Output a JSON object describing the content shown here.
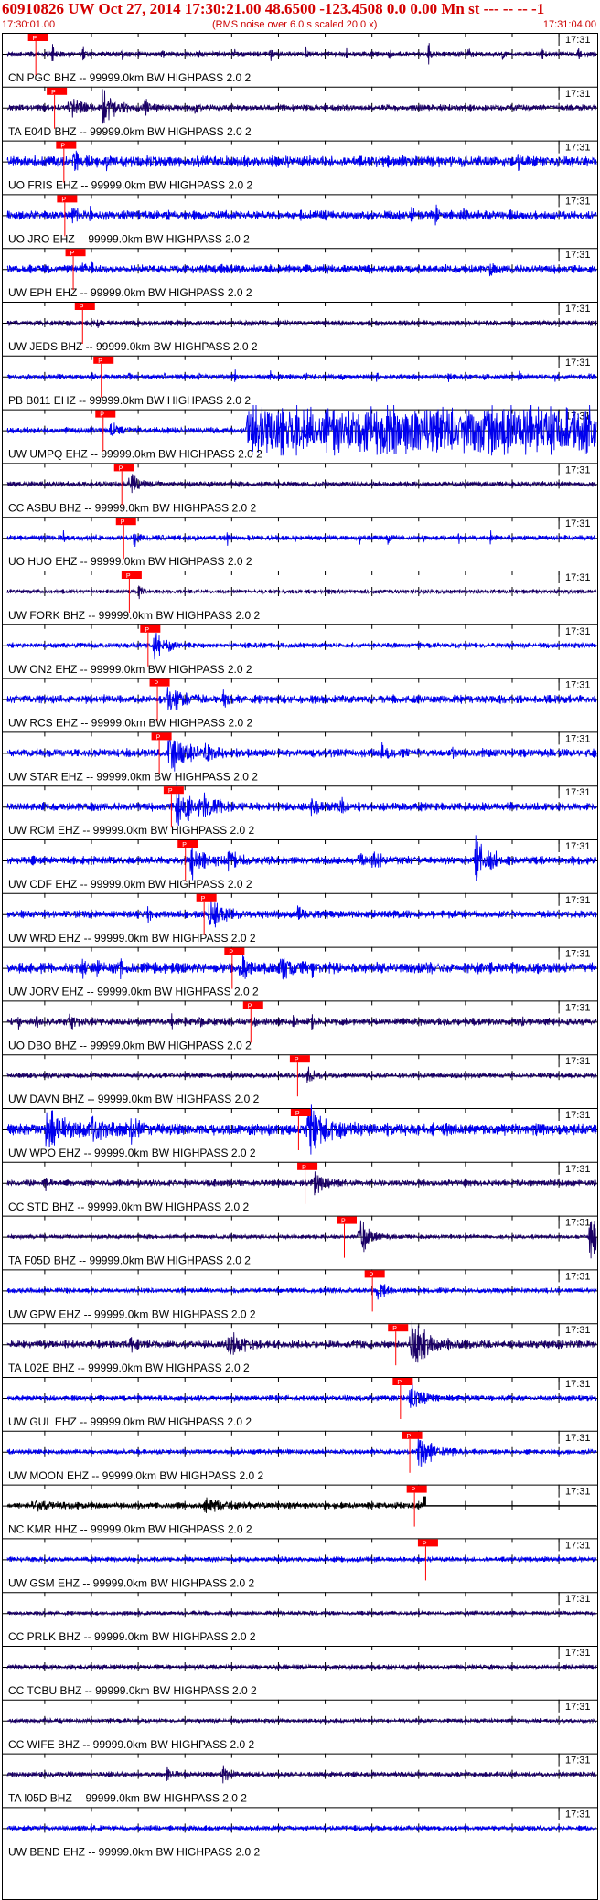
{
  "header": {
    "title": "60910826 UW Oct 27, 2014 17:30:21.00   48.6500  -123.4508   0.0  0.00 Mn st --- -- --  -1",
    "start_time": "17:30:01.00",
    "rms_note": "(RMS noise over 6.0 s scaled 20.0 x)",
    "end_time": "17:31:04.00"
  },
  "chart_data": {
    "type": "line",
    "title": "60910826 UW Oct 27, 2014 17:30:21.00   48.6500  -123.4508   0.0  0.00 Mn st --- -- --  -1",
    "time_axis": {
      "start": "17:30:01.00",
      "end": "17:31:04.00",
      "minute_tick_label": "17:31",
      "start_seconds": 1.0,
      "end_seconds": 64.0,
      "minute_mark_seconds": 60.0
    },
    "pick_label": "P",
    "colors": {
      "trace_blue": "#0000ee",
      "trace_dark": "#1a0066",
      "pick": "#ff0000",
      "header_text": "#cc0000",
      "axis": "#000000"
    },
    "series": [
      {
        "name": "CN PGC BHZ -- 99999.0km BW  HIGHPASS  2.0  2",
        "color": "#1a0066",
        "pick_seconds": 4.0,
        "amp": 0.35,
        "noise": 0.08,
        "seed": 1,
        "events": [
          [
            5.8,
            0.25,
            0.5
          ],
          [
            9.0,
            0.25,
            0.5
          ],
          [
            13.2,
            0.2,
            0.5
          ],
          [
            17.5,
            0.2,
            0.5
          ],
          [
            21.5,
            0.2,
            0.5
          ],
          [
            25.3,
            0.2,
            0.5
          ],
          [
            29.1,
            0.25,
            0.5
          ],
          [
            32.9,
            0.2,
            0.5
          ],
          [
            37.2,
            0.2,
            0.5
          ],
          [
            41.8,
            0.2,
            0.5
          ],
          [
            46.0,
            0.3,
            0.6
          ],
          [
            50.3,
            0.3,
            0.5
          ],
          [
            53.9,
            0.2,
            0.5
          ],
          [
            58.1,
            0.2,
            0.5
          ],
          [
            62.0,
            0.2,
            0.5
          ]
        ]
      },
      {
        "name": "TA E04D BHZ -- 99999.0km BW  HIGHPASS  2.0  2",
        "color": "#1a0066",
        "pick_seconds": 6.0,
        "amp": 0.45,
        "noise": 0.12,
        "seed": 2,
        "events": [
          [
            7.5,
            1.5,
            0.6
          ],
          [
            11.0,
            2.0,
            0.9
          ],
          [
            15.5,
            0.8,
            0.4
          ],
          [
            21.0,
            0.5,
            0.3
          ]
        ]
      },
      {
        "name": "UO FRIS EHZ -- 99999.0km BW  HIGHPASS  2.0  2",
        "color": "#0000ee",
        "pick_seconds": 7.0,
        "amp": 0.4,
        "noise": 0.22,
        "seed": 3,
        "events": [
          [
            8.0,
            1.0,
            0.5
          ],
          [
            11.5,
            0.5,
            0.3
          ],
          [
            52.3,
            0.2,
            1.0
          ],
          [
            55.6,
            0.2,
            0.9
          ]
        ]
      },
      {
        "name": "UO JRO EHZ -- 99999.0km BW  HIGHPASS  2.0  2",
        "color": "#0000ee",
        "pick_seconds": 7.1,
        "amp": 0.4,
        "noise": 0.18,
        "seed": 4,
        "events": [
          [
            7.9,
            0.6,
            0.4
          ],
          [
            9.8,
            0.15,
            0.5
          ],
          [
            44.2,
            0.2,
            1.0
          ],
          [
            46.8,
            0.2,
            0.9
          ],
          [
            49.8,
            0.2,
            0.5
          ]
        ]
      },
      {
        "name": "UW EPH EHZ -- 99999.0km BW  HIGHPASS  2.0  2",
        "color": "#0000ee",
        "pick_seconds": 8.0,
        "amp": 0.4,
        "noise": 0.16,
        "seed": 5,
        "events": [
          [
            9.0,
            0.5,
            0.3
          ],
          [
            10.0,
            0.15,
            0.4
          ],
          [
            52.6,
            0.2,
            1.0
          ]
        ]
      },
      {
        "name": "UW JEDS BHZ -- 99999.0km BW  HIGHPASS  2.0  2",
        "color": "#1a0066",
        "pick_seconds": 9.0,
        "amp": 0.3,
        "noise": 0.08,
        "seed": 6,
        "events": [
          [
            10.5,
            0.5,
            0.3
          ]
        ]
      },
      {
        "name": "PB B011 EHZ -- 99999.0km BW  HIGHPASS  2.0  2",
        "color": "#0000ee",
        "pick_seconds": 11.0,
        "amp": 0.35,
        "noise": 0.08,
        "seed": 7,
        "events": [
          [
            3.0,
            0.2,
            0.4
          ],
          [
            6.3,
            0.2,
            0.4
          ],
          [
            10.1,
            0.2,
            0.4
          ],
          [
            13.9,
            0.2,
            0.5
          ],
          [
            17.7,
            0.2,
            0.4
          ],
          [
            21.5,
            0.2,
            0.4
          ],
          [
            25.3,
            0.2,
            0.4
          ],
          [
            29.1,
            0.2,
            0.4
          ],
          [
            32.9,
            0.2,
            0.4
          ],
          [
            36.7,
            0.2,
            0.4
          ],
          [
            40.5,
            0.2,
            0.4
          ],
          [
            44.3,
            0.2,
            0.4
          ],
          [
            48.1,
            0.2,
            0.4
          ],
          [
            51.9,
            0.2,
            0.4
          ],
          [
            55.7,
            0.2,
            0.4
          ],
          [
            59.5,
            0.2,
            0.4
          ],
          [
            63.2,
            0.2,
            0.4
          ]
        ]
      },
      {
        "name": "UW UMPQ EHZ -- 99999.0km BW  HIGHPASS  2.0  2",
        "color": "#0000ee",
        "pick_seconds": 11.2,
        "amp": 0.45,
        "noise": 0.12,
        "seed": 8,
        "events": [
          [
            12.0,
            0.8,
            0.5
          ]
        ],
        "burst": [
          [
            26.5,
            30.0,
            1.0
          ],
          [
            30.0,
            64.0,
            0.95
          ]
        ]
      },
      {
        "name": "CC ASBU BHZ -- 99999.0km BW  HIGHPASS  2.0  2",
        "color": "#1a0066",
        "pick_seconds": 13.2,
        "amp": 0.35,
        "noise": 0.1,
        "seed": 9,
        "events": [
          [
            14.0,
            1.2,
            0.7
          ]
        ]
      },
      {
        "name": "UO HUO EHZ -- 99999.0km BW  HIGHPASS  2.0  2",
        "color": "#0000ee",
        "pick_seconds": 13.4,
        "amp": 0.35,
        "noise": 0.1,
        "seed": 10,
        "events": [
          [
            7.0,
            0.15,
            0.5
          ],
          [
            10.5,
            0.15,
            0.5
          ],
          [
            14.5,
            0.4,
            0.6
          ],
          [
            17.5,
            0.15,
            0.5
          ],
          [
            21.0,
            0.15,
            0.5
          ],
          [
            24.5,
            0.15,
            0.5
          ],
          [
            31.7,
            0.15,
            0.5
          ],
          [
            38.7,
            0.15,
            0.5
          ],
          [
            41.7,
            0.15,
            0.5
          ],
          [
            45.4,
            0.15,
            0.6
          ],
          [
            49.2,
            0.15,
            0.5
          ],
          [
            52.6,
            0.15,
            0.5
          ],
          [
            59.7,
            0.15,
            0.5
          ]
        ]
      },
      {
        "name": "UW FORK BHZ -- 99999.0km BW  HIGHPASS  2.0  2",
        "color": "#1a0066",
        "pick_seconds": 14.0,
        "amp": 0.3,
        "noise": 0.08,
        "seed": 11,
        "events": [
          [
            15.0,
            0.5,
            0.3
          ]
        ]
      },
      {
        "name": "UW ON2 EHZ -- 99999.0km BW  HIGHPASS  2.0  2",
        "color": "#0000ee",
        "pick_seconds": 16.0,
        "amp": 0.35,
        "noise": 0.1,
        "seed": 12,
        "events": [
          [
            16.6,
            0.8,
            1.0
          ],
          [
            18.0,
            0.8,
            0.4
          ]
        ]
      },
      {
        "name": "UW RCS EHZ -- 99999.0km BW  HIGHPASS  2.0  2",
        "color": "#0000ee",
        "pick_seconds": 17.0,
        "amp": 0.35,
        "noise": 0.16,
        "seed": 13,
        "events": [
          [
            18.0,
            2.0,
            0.7
          ],
          [
            24.0,
            1.0,
            0.3
          ]
        ]
      },
      {
        "name": "UW STAR EHZ -- 99999.0km BW  HIGHPASS  2.0  2",
        "color": "#0000ee",
        "pick_seconds": 17.2,
        "amp": 0.35,
        "noise": 0.16,
        "seed": 14,
        "events": [
          [
            18.2,
            2.5,
            0.9
          ],
          [
            22.0,
            1.2,
            0.4
          ],
          [
            41.0,
            1.0,
            0.3
          ],
          [
            48.5,
            0.5,
            0.25
          ]
        ]
      },
      {
        "name": "UW RCM EHZ -- 99999.0km BW  HIGHPASS  2.0  2",
        "color": "#0000ee",
        "pick_seconds": 18.5,
        "amp": 0.4,
        "noise": 0.16,
        "seed": 15,
        "events": [
          [
            19.0,
            2.5,
            1.0
          ],
          [
            22.0,
            1.5,
            0.6
          ],
          [
            33.5,
            0.8,
            0.4
          ],
          [
            36.5,
            0.8,
            0.35
          ]
        ]
      },
      {
        "name": "UW CDF EHZ -- 99999.0km BW  HIGHPASS  2.0  2",
        "color": "#0000ee",
        "pick_seconds": 20.0,
        "amp": 0.35,
        "noise": 0.16,
        "seed": 16,
        "events": [
          [
            20.5,
            2.0,
            0.6
          ],
          [
            24.5,
            1.5,
            0.4
          ],
          [
            38.5,
            1.0,
            0.3
          ],
          [
            40.0,
            1.0,
            0.35
          ],
          [
            51.0,
            1.5,
            1.0
          ],
          [
            52.8,
            0.5,
            0.6
          ]
        ]
      },
      {
        "name": "UW WRD EHZ -- 99999.0km BW  HIGHPASS  2.0  2",
        "color": "#0000ee",
        "pick_seconds": 22.0,
        "amp": 0.35,
        "noise": 0.15,
        "seed": 17,
        "events": [
          [
            16.0,
            0.4,
            0.4
          ],
          [
            22.5,
            2.0,
            0.6
          ],
          [
            32.0,
            0.5,
            0.3
          ]
        ]
      },
      {
        "name": "UW JORV EHZ -- 99999.0km BW  HIGHPASS  2.0  2",
        "color": "#0000ee",
        "pick_seconds": 25.0,
        "amp": 0.35,
        "noise": 0.2,
        "seed": 18,
        "events": [
          [
            9.0,
            0.3,
            0.45
          ],
          [
            10.5,
            0.3,
            0.4
          ],
          [
            13.0,
            0.3,
            0.55
          ],
          [
            25.8,
            1.5,
            0.6
          ],
          [
            30.0,
            2.0,
            0.5
          ],
          [
            33.5,
            0.4,
            0.3
          ],
          [
            40.5,
            0.4,
            0.3
          ],
          [
            45.8,
            0.4,
            0.3
          ]
        ]
      },
      {
        "name": "UO DBO BHZ -- 99999.0km BW  HIGHPASS  2.0  2",
        "color": "#1a0066",
        "pick_seconds": 27.0,
        "amp": 0.35,
        "noise": 0.14,
        "seed": 19,
        "events": [
          [
            2.0,
            0.3,
            0.5
          ],
          [
            4.0,
            0.3,
            0.35
          ],
          [
            7.5,
            1.0,
            0.3
          ],
          [
            18.5,
            0.3,
            0.3
          ],
          [
            21.5,
            0.3,
            0.4
          ],
          [
            27.5,
            0.3,
            0.4
          ],
          [
            31.5,
            0.3,
            0.4
          ],
          [
            33.5,
            0.3,
            0.4
          ],
          [
            56.0,
            0.3,
            0.3
          ]
        ]
      },
      {
        "name": "UW DAVN BHZ -- 99999.0km BW  HIGHPASS  2.0  2",
        "color": "#1a0066",
        "pick_seconds": 32.0,
        "amp": 0.3,
        "noise": 0.1,
        "seed": 20,
        "events": [
          [
            33.0,
            1.0,
            0.4
          ]
        ]
      },
      {
        "name": "UW WPO EHZ -- 99999.0km BW  HIGHPASS  2.0  2",
        "color": "#0000ee",
        "pick_seconds": 32.1,
        "amp": 0.45,
        "noise": 0.22,
        "seed": 21,
        "events": [
          [
            5.0,
            4.0,
            0.65
          ],
          [
            10.0,
            2.0,
            0.5
          ],
          [
            14.0,
            1.5,
            0.4
          ],
          [
            33.0,
            3.0,
            0.9
          ],
          [
            47.5,
            0.6,
            0.3
          ]
        ]
      },
      {
        "name": "CC STD BHZ -- 99999.0km BW  HIGHPASS  2.0  2",
        "color": "#1a0066",
        "pick_seconds": 32.8,
        "amp": 0.3,
        "noise": 0.12,
        "seed": 22,
        "events": [
          [
            5.0,
            0.6,
            0.3
          ],
          [
            33.8,
            1.5,
            0.5
          ]
        ]
      },
      {
        "name": "TA F05D BHZ -- 99999.0km BW  HIGHPASS  2.0  2",
        "color": "#1a0066",
        "pick_seconds": 37.0,
        "amp": 0.4,
        "noise": 0.08,
        "seed": 23,
        "events": [
          [
            38.5,
            1.5,
            1.0
          ],
          [
            63.2,
            1.5,
            1.1
          ]
        ]
      },
      {
        "name": "UW GPW EHZ -- 99999.0km BW  HIGHPASS  2.0  2",
        "color": "#0000ee",
        "pick_seconds": 40.0,
        "amp": 0.3,
        "noise": 0.1,
        "seed": 24,
        "events": [
          [
            40.5,
            1.0,
            0.5
          ]
        ]
      },
      {
        "name": "TA L02E BHZ -- 99999.0km BW  HIGHPASS  2.0  2",
        "color": "#1a0066",
        "pick_seconds": 42.5,
        "amp": 0.4,
        "noise": 0.15,
        "seed": 25,
        "events": [
          [
            14.0,
            0.8,
            0.3
          ],
          [
            24.5,
            2.0,
            0.6
          ],
          [
            44.0,
            3.0,
            0.9
          ]
        ]
      },
      {
        "name": "UW GUL EHZ -- 99999.0km BW  HIGHPASS  2.0  2",
        "color": "#0000ee",
        "pick_seconds": 43.0,
        "amp": 0.35,
        "noise": 0.1,
        "seed": 26,
        "events": [
          [
            44.0,
            1.5,
            0.7
          ]
        ]
      },
      {
        "name": "UW MOON EHZ -- 99999.0km BW  HIGHPASS  2.0  2",
        "color": "#0000ee",
        "pick_seconds": 44.0,
        "amp": 0.3,
        "noise": 0.1,
        "seed": 27,
        "events": [
          [
            44.8,
            2.5,
            0.7
          ]
        ]
      },
      {
        "name": "NC KMR HHZ -- 99999.0km BW  HIGHPASS  2.0  2",
        "color": "#000000",
        "pick_seconds": 44.5,
        "amp": 0.35,
        "noise": 0.12,
        "seed": 28,
        "events": [
          [
            3.5,
            4.0,
            0.2
          ],
          [
            22.0,
            4.0,
            0.2
          ]
        ],
        "step_at": 45.6
      },
      {
        "name": "UW GSM EHZ -- 99999.0km BW  HIGHPASS  2.0  2",
        "color": "#0000ee",
        "pick_seconds": 45.7,
        "amp": 0.3,
        "noise": 0.1,
        "seed": 29,
        "events": []
      },
      {
        "name": "CC PRLK BHZ -- 99999.0km BW  HIGHPASS  2.0  2",
        "color": "#1a0066",
        "pick_seconds": null,
        "amp": 0.3,
        "noise": 0.08,
        "seed": 30,
        "events": []
      },
      {
        "name": "CC TCBU BHZ -- 99999.0km BW  HIGHPASS  2.0  2",
        "color": "#1a0066",
        "pick_seconds": null,
        "amp": 0.3,
        "noise": 0.08,
        "seed": 31,
        "events": []
      },
      {
        "name": "CC WIFE BHZ -- 99999.0km BW  HIGHPASS  2.0  2",
        "color": "#1a0066",
        "pick_seconds": null,
        "amp": 0.3,
        "noise": 0.08,
        "seed": 32,
        "events": []
      },
      {
        "name": "TA I05D BHZ -- 99999.0km BW  HIGHPASS  2.0  2",
        "color": "#1a0066",
        "pick_seconds": null,
        "amp": 0.3,
        "noise": 0.1,
        "seed": 33,
        "events": [
          [
            18.0,
            1.0,
            0.2
          ],
          [
            24.0,
            1.0,
            0.3
          ]
        ]
      },
      {
        "name": "UW BEND EHZ -- 99999.0km BW  HIGHPASS  2.0  2",
        "color": "#0000ee",
        "pick_seconds": null,
        "amp": 0.3,
        "noise": 0.1,
        "seed": 34,
        "events": []
      }
    ]
  }
}
